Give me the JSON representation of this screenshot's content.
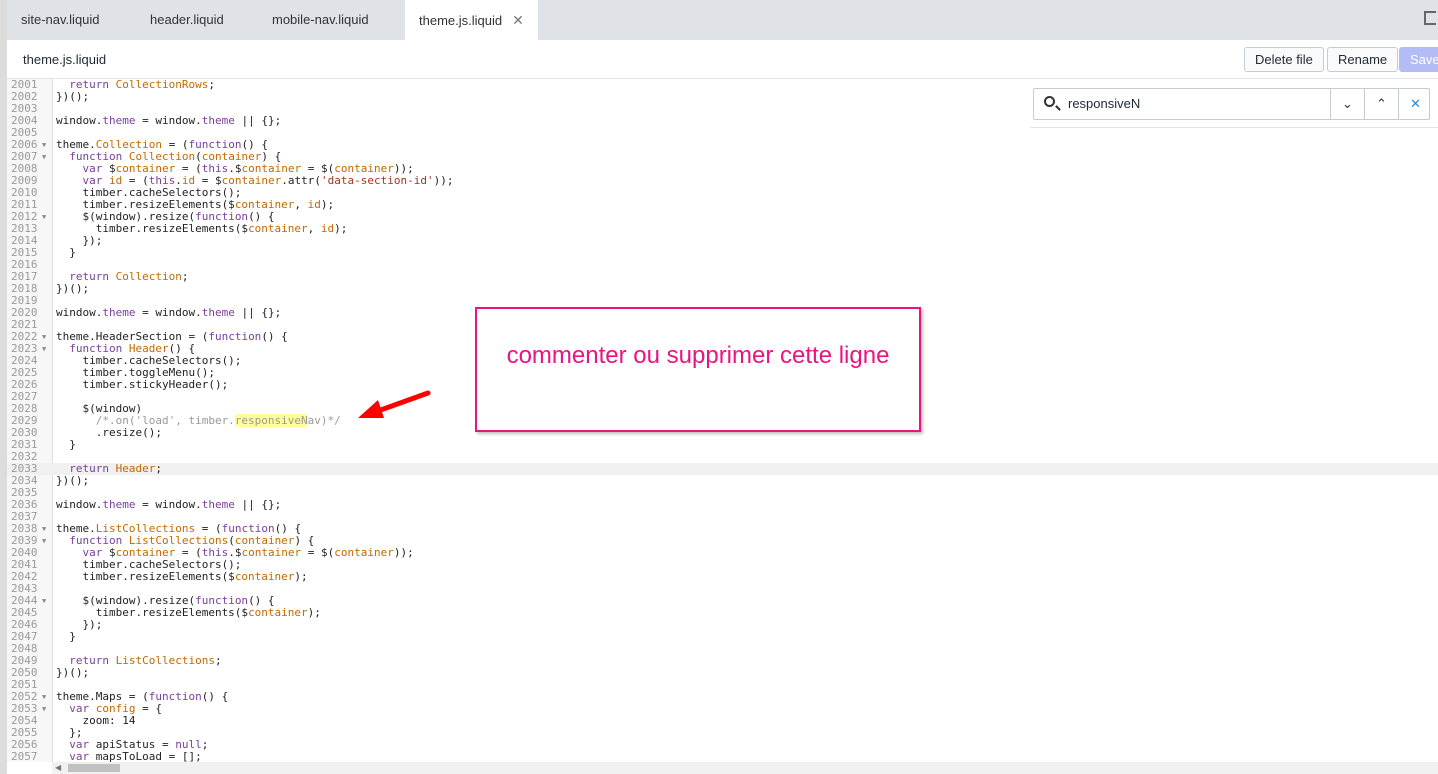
{
  "tabs": [
    {
      "label": "site-nav.liquid"
    },
    {
      "label": "header.liquid"
    },
    {
      "label": "mobile-nav.liquid"
    },
    {
      "label": "theme.js.liquid",
      "active": true
    }
  ],
  "file_title": "theme.js.liquid",
  "buttons": {
    "delete": "Delete file",
    "rename": "Rename",
    "save": "Save"
  },
  "search": {
    "value": "responsiveN",
    "next": "⌄",
    "prev": "⌃",
    "close": "✕"
  },
  "annotation": "commenter ou supprimer cette ligne",
  "colors": {
    "annotation": "#e8157f",
    "arrow": "#ff0000",
    "highlight": "#ffff99"
  },
  "code": {
    "start": 2001,
    "active_line": 2033,
    "folds": [
      2006,
      2007,
      2012,
      2022,
      2023,
      2038,
      2039,
      2044,
      2052,
      2053
    ],
    "lines": [
      "  return CollectionRows;",
      "})();",
      "",
      "window.theme = window.theme || {};",
      "",
      "theme.Collection = (function() {",
      "  function Collection(container) {",
      "    var $container = (this.$container = $(container));",
      "    var id = (this.id = $container.attr('data-section-id'));",
      "    timber.cacheSelectors();",
      "    timber.resizeElements($container, id);",
      "    $(window).resize(function() {",
      "      timber.resizeElements($container, id);",
      "    });",
      "  }",
      "",
      "  return Collection;",
      "})();",
      "",
      "window.theme = window.theme || {};",
      "",
      "theme.HeaderSection = (function() {",
      "  function Header() {",
      "    timber.cacheSelectors();",
      "    timber.toggleMenu();",
      "    timber.stickyHeader();",
      "",
      "    $(window)",
      "      /*.on('load', timber.responsiveNav)*/",
      "      .resize();",
      "  }",
      "",
      "  return Header;",
      "})();",
      "",
      "window.theme = window.theme || {};",
      "",
      "theme.ListCollections = (function() {",
      "  function ListCollections(container) {",
      "    var $container = (this.$container = $(container));",
      "    timber.cacheSelectors();",
      "    timber.resizeElements($container);",
      "",
      "    $(window).resize(function() {",
      "      timber.resizeElements($container);",
      "    });",
      "  }",
      "",
      "  return ListCollections;",
      "})();",
      "",
      "theme.Maps = (function() {",
      "  var config = {",
      "    zoom: 14",
      "  };",
      "  var apiStatus = null;",
      "  var mapsToLoad = [];",
      ""
    ]
  }
}
